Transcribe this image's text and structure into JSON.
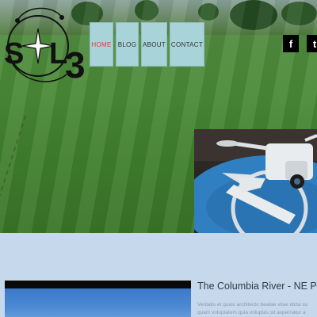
{
  "brand": {
    "logo_text": "SOL3"
  },
  "nav": {
    "items": [
      {
        "label": "HOME",
        "active": true
      },
      {
        "label": "BLOG",
        "active": false
      },
      {
        "label": "ABOUT",
        "active": false
      },
      {
        "label": "CONTACT",
        "active": false
      }
    ]
  },
  "social": {
    "facebook_glyph": "f",
    "twitter_glyph": "t"
  },
  "colors": {
    "nav_bg": "#a8d3d8",
    "nav_active_text": "#e53935",
    "section_bg": "#c6d9ec"
  },
  "post": {
    "title": "The Columbia River - NE Port",
    "excerpt_line1": "Veritatis et quasi architecto beatae vitae dicta su",
    "excerpt_line2": "quam voluptatem quia voluptas sit aspernatur a"
  }
}
